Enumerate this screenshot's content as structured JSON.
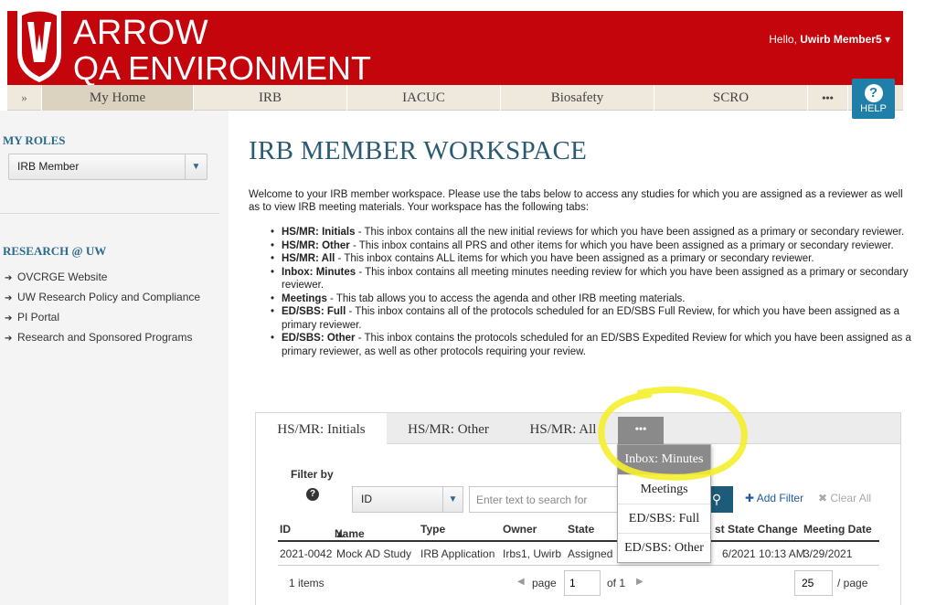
{
  "header": {
    "brand_line1": "ARROW",
    "brand_line2": "QA ENVIRONMENT",
    "greeting": "Hello,",
    "user_name": "Uwirb Member5",
    "brand_color": "#c5050c"
  },
  "nav": {
    "expand_label": "»",
    "items": [
      "My Home",
      "IRB",
      "IACUC",
      "Biosafety",
      "SCRO"
    ],
    "more_label": "•••",
    "help_label": "HELP"
  },
  "sidebar": {
    "roles_heading": "MY ROLES",
    "role_selected": "IRB Member",
    "research_heading": "RESEARCH @ UW",
    "links": [
      "OVCRGE Website",
      "UW Research Policy and Compliance",
      "PI Portal",
      "Research and Sponsored Programs"
    ]
  },
  "main": {
    "title": "IRB MEMBER WORKSPACE",
    "intro": "Welcome to your IRB member workspace. Please use the tabs below to access any studies for which you are assigned as a reviewer as well as to view IRB meeting materials. Your workspace has the following tabs:",
    "bullets": [
      {
        "term": "HS/MR: Initials",
        "text": " - This inbox contains all the new initial reviews for which you have been assigned as a primary or secondary reviewer."
      },
      {
        "term": "HS/MR: Other",
        "text": " - This inbox contains all PRS and other items for which you have been assigned as a primary or secondary reviewer."
      },
      {
        "term": "HS/MR: All",
        "text": " - This inbox contains ALL items for which you have been assigned as a primary or secondary reviewer."
      },
      {
        "term": "Inbox: Minutes",
        "text": " - This inbox contains all meeting minutes needing review for which you have been assigned as a primary or secondary reviewer."
      },
      {
        "term": "Meetings",
        "text": " - This tab allows you to access the agenda and other IRB meeting materials."
      },
      {
        "term": "ED/SBS: Full",
        "text": " - This inbox contains all of the protocols scheduled for an ED/SBS Full Review, for which you have been assigned as a primary reviewer."
      },
      {
        "term": "ED/SBS: Other",
        "text": " - This inbox contains the protocols scheduled for an ED/SBS Expedited Review for which you have been assigned as a primary reviewer, as well as other protocols requiring your review."
      }
    ]
  },
  "tabs": {
    "items": [
      "HS/MR: Initials",
      "HS/MR: Other",
      "HS/MR: All"
    ],
    "more_label": "•••",
    "overflow": [
      "Inbox: Minutes",
      "Meetings",
      "ED/SBS: Full",
      "ED/SBS: Other"
    ]
  },
  "filter": {
    "label": "Filter by",
    "help_icon": "?",
    "field_selected": "ID",
    "search_placeholder": "Enter text to search for",
    "add_filter": "Add Filter",
    "clear_all": "Clear All"
  },
  "table": {
    "headers": [
      "ID",
      "Name",
      "Type",
      "Owner",
      "State",
      "st State Change",
      "Meeting Date"
    ],
    "rows": [
      [
        "2021-0042",
        "Mock AD Study",
        "IRB Application",
        "Irbs1, Uwirb",
        "Assigned",
        "6/2021 10:13 AM",
        "3/29/2021"
      ]
    ]
  },
  "pager": {
    "items_count": "1 items",
    "page_label": "page",
    "page_value": "1",
    "of_label": "of 1",
    "page_size": "25",
    "per_page_label": "/ page"
  }
}
